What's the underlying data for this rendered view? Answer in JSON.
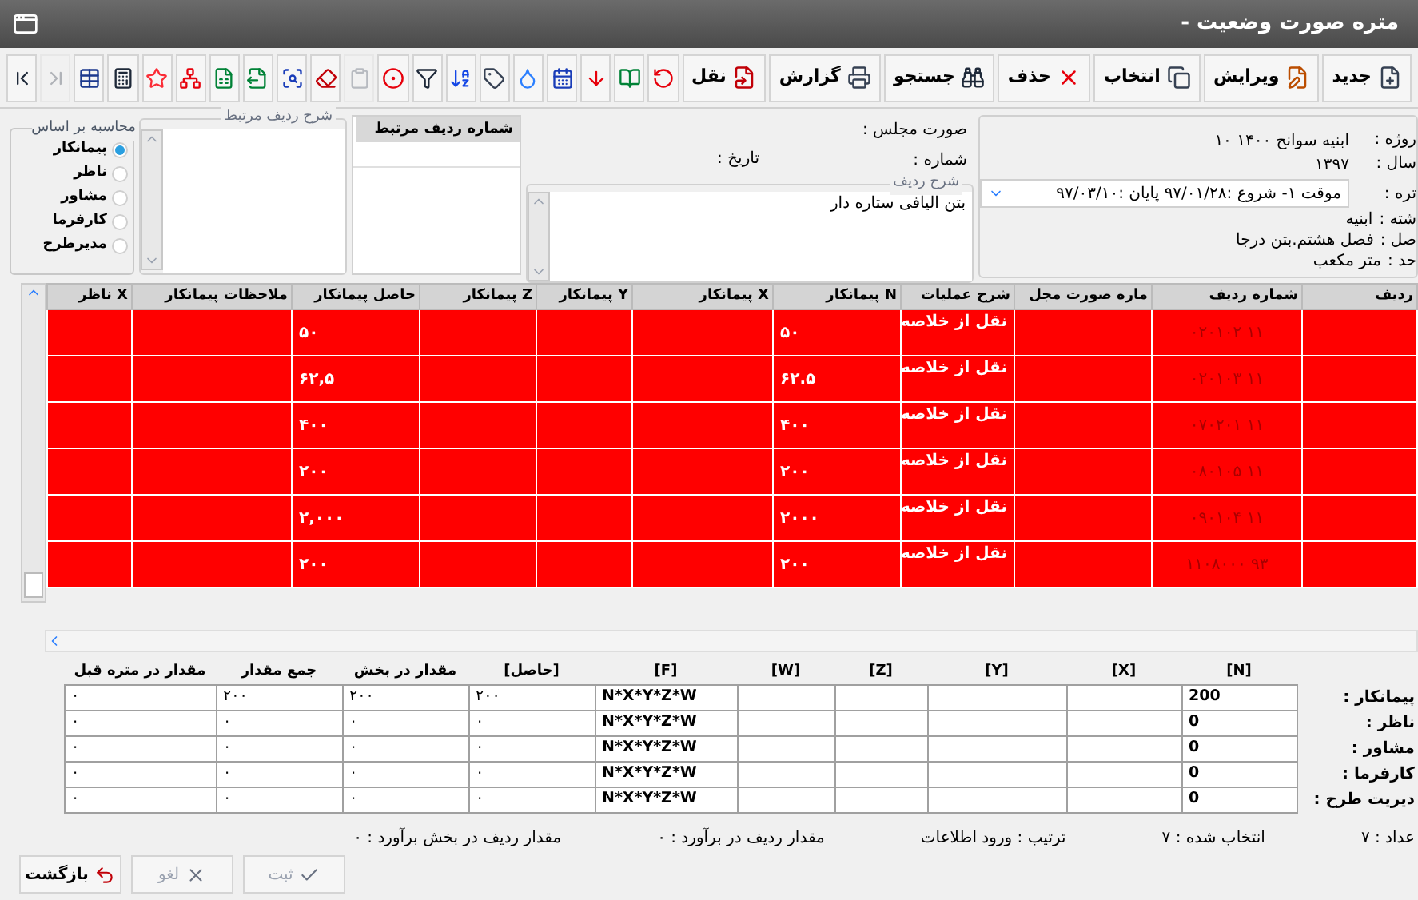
{
  "window": {
    "title": "متره صورت وضعیت -"
  },
  "toolbar": {
    "buttons": [
      {
        "label": "جدید",
        "kind": "new"
      },
      {
        "label": "ویرایش",
        "kind": "edit"
      },
      {
        "label": "انتخاب",
        "kind": "select"
      },
      {
        "label": "حذف",
        "kind": "delete"
      },
      {
        "label": "جستجو",
        "kind": "search"
      },
      {
        "label": "گزارش",
        "kind": "report"
      },
      {
        "label": "نقل",
        "kind": "transfer"
      }
    ],
    "icon_buttons": [
      {
        "kind": "refresh",
        "disabled": false
      },
      {
        "kind": "book",
        "disabled": false
      },
      {
        "kind": "arrow-down",
        "disabled": false
      },
      {
        "kind": "calendar",
        "disabled": false
      },
      {
        "kind": "drop",
        "disabled": false
      },
      {
        "kind": "tag",
        "disabled": false
      },
      {
        "kind": "sort",
        "disabled": false
      },
      {
        "kind": "filter",
        "disabled": false
      },
      {
        "kind": "target",
        "disabled": false
      },
      {
        "kind": "clipboard",
        "disabled": true
      },
      {
        "kind": "eraser",
        "disabled": false
      },
      {
        "kind": "find",
        "disabled": false
      },
      {
        "kind": "export",
        "disabled": false
      },
      {
        "kind": "excel",
        "disabled": false
      },
      {
        "kind": "hierarchy",
        "disabled": false
      },
      {
        "kind": "star",
        "disabled": false
      },
      {
        "kind": "calculator",
        "disabled": false
      },
      {
        "kind": "grid",
        "disabled": false
      },
      {
        "kind": "last",
        "disabled": true
      },
      {
        "kind": "first",
        "disabled": false
      }
    ]
  },
  "info": {
    "project": {
      "label": "روژه :",
      "value": "ابنیه سوانح ۱۴۰۰ ۱۰"
    },
    "year": {
      "label": "سال :",
      "value": "۱۳۹۷"
    },
    "measure": {
      "label": "تره :",
      "value": "موقت ۱- شروع :۹۷/۰۱/۲۸ پایان :۹۷/۰۳/۱۰"
    },
    "details": [
      {
        "label": "شته :",
        "value": "ابنیه"
      },
      {
        "label": "صل :",
        "value": "فصل هشتم.بتن درجا"
      },
      {
        "label": "حد :",
        "value": "متر مکعب"
      }
    ]
  },
  "record": {
    "minutes_label": "صورت مجلس :",
    "number_label": "شماره :",
    "date_label": "تاریخ :",
    "description_legend": "شرح ردیف",
    "description": "بتن الیافی ستاره دار"
  },
  "related": {
    "column": "شماره ردیف مرتبط",
    "description_legend": "شرح ردیف مرتبط"
  },
  "calculation": {
    "legend": "محاسبه بر اساس",
    "options": [
      {
        "label": "پیمانکار",
        "selected": true
      },
      {
        "label": "ناظر",
        "selected": false
      },
      {
        "label": "مشاور",
        "selected": false
      },
      {
        "label": "کارفرما",
        "selected": false
      },
      {
        "label": "مدیرطرح",
        "selected": false
      }
    ]
  },
  "table": {
    "columns": [
      "ردیف",
      "شماره ردیف",
      "ماره صورت مجل",
      "شرح عملیات",
      "N پیمانکار",
      "X پیمانکار",
      "Y پیمانکار",
      "Z پیمانکار",
      "حاصل پیمانکار",
      "ملاحظات پیمانکار",
      "X ناظر"
    ],
    "rows": [
      {
        "number": "۱۱ ۰۲۰۱۰۲",
        "operation": "نقل از خلاصه",
        "n": "۵۰",
        "result": "۵۰"
      },
      {
        "number": "۱۱ ۰۲۰۱۰۳",
        "operation": "نقل از خلاصه",
        "n": "۶۲.۵",
        "result": "۶۲,۵"
      },
      {
        "number": "۱۱ ۰۷۰۲۰۱",
        "operation": "نقل از خلاصه",
        "n": "۴۰۰",
        "result": "۴۰۰"
      },
      {
        "number": "۱۱ ۰۸۰۱۰۵",
        "operation": "نقل از خلاصه",
        "n": "۲۰۰",
        "result": "۲۰۰"
      },
      {
        "number": "۱۱ ۰۹۰۱۰۴",
        "operation": "نقل از خلاصه",
        "n": "۲۰۰۰",
        "result": "۲,۰۰۰"
      },
      {
        "number": "۹۳ ۱۱۰۸۰۰۰",
        "operation": "نقل از خلاصه",
        "n": "۲۰۰",
        "result": "۲۰۰"
      }
    ]
  },
  "summary": {
    "columns": [
      "[N]",
      "[X]",
      "[Y]",
      "[Z]",
      "[W]",
      "[F]",
      "[حاصل]",
      "مقدار در بخش",
      "جمع مقدار",
      "مقدار در متره قبل"
    ],
    "rows": [
      {
        "label": "پیمانکار :",
        "n": "200",
        "formula": "N*X*Y*Z*W",
        "result": "۲۰۰",
        "section": "۲۰۰",
        "total": "۲۰۰",
        "previous": "۰"
      },
      {
        "label": "ناظر :",
        "n": "0",
        "formula": "N*X*Y*Z*W",
        "result": "۰",
        "section": "۰",
        "total": "۰",
        "previous": "۰"
      },
      {
        "label": "مشاور :",
        "n": "0",
        "formula": "N*X*Y*Z*W",
        "result": "۰",
        "section": "۰",
        "total": "۰",
        "previous": "۰"
      },
      {
        "label": "کارفرما :",
        "n": "0",
        "formula": "N*X*Y*Z*W",
        "result": "۰",
        "section": "۰",
        "total": "۰",
        "previous": "۰"
      },
      {
        "label": "دیریت طرح :",
        "n": "0",
        "formula": "N*X*Y*Z*W",
        "result": "۰",
        "section": "۰",
        "total": "۰",
        "previous": "۰"
      }
    ]
  },
  "status_bar": [
    "عداد : ۷",
    "انتخاب شده : ۷",
    "ترتیب : ورود اطلاعات",
    "مقدار ردیف در برآورد : ۰",
    "مقدار ردیف در بخش برآورد : ۰"
  ],
  "footer_buttons": [
    {
      "label": "ثبت",
      "kind": "save",
      "disabled": true
    },
    {
      "label": "لغو",
      "kind": "cancel",
      "disabled": true
    },
    {
      "label": "بازگشت",
      "kind": "back",
      "disabled": false
    }
  ]
}
